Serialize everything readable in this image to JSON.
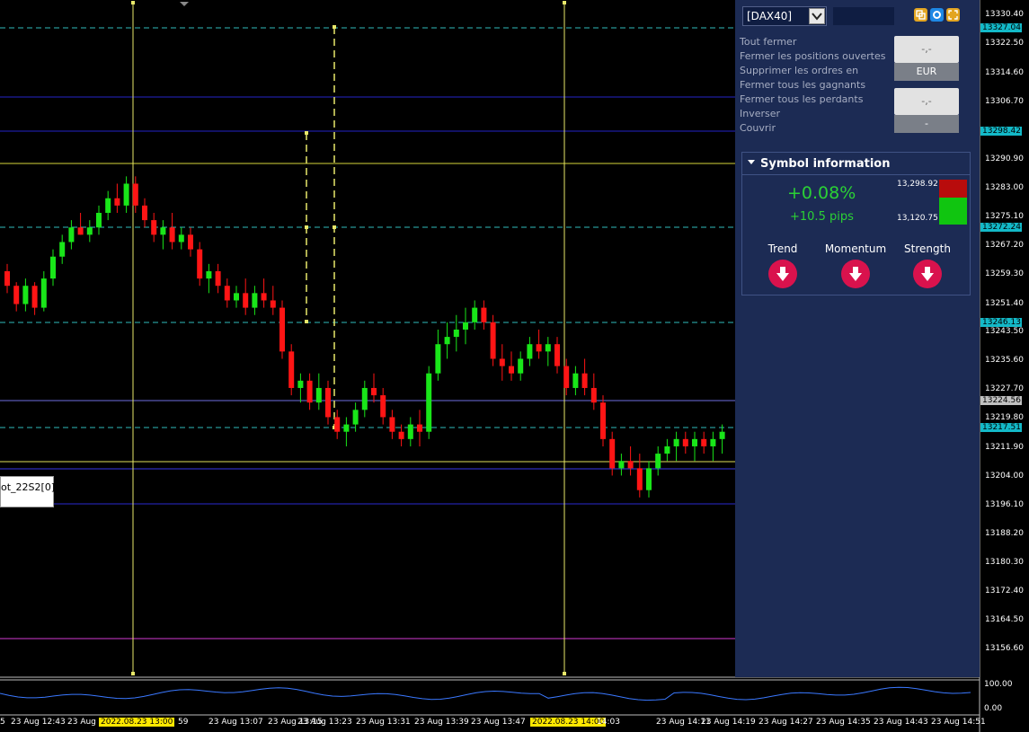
{
  "symbol_panel": {
    "symbol": "[DAX40]",
    "menu": [
      "Tout fermer",
      "Fermer les positions ouvertes",
      "Supprimer les ordres en",
      "Fermer tous les gagnants",
      "Fermer tous les perdants",
      "Inverser",
      "Couvrir"
    ],
    "btn1_value": "-,-",
    "btn1_currency": "EUR",
    "btn2_value": "-,-",
    "btn2_sub": "-"
  },
  "symbol_info": {
    "title": "Symbol information",
    "change_pct": "+0.08%",
    "change_pips": "+10.5 pips",
    "high": "13,298.92",
    "low": "13,120.75",
    "indicators": [
      {
        "label": "Trend",
        "direction": "down"
      },
      {
        "label": "Momentum",
        "direction": "down"
      },
      {
        "label": "Strength",
        "direction": "down"
      }
    ]
  },
  "price_axis": [
    "13330.40",
    "13322.50",
    "13314.60",
    "13306.70",
    "13290.90",
    "13283.00",
    "13275.10",
    "13267.20",
    "13259.30",
    "13251.40",
    "13243.50",
    "13235.60",
    "13227.70",
    "13219.80",
    "13211.90",
    "13204.00",
    "13196.10",
    "13188.20",
    "13180.30",
    "13172.40",
    "13164.50",
    "13156.60"
  ],
  "price_badges": [
    {
      "value": "13327.04",
      "color": "#13b9c8"
    },
    {
      "value": "13298.42",
      "color": "#13b9c8"
    },
    {
      "value": "13272.24",
      "color": "#13b9c8"
    },
    {
      "value": "13246.13",
      "color": "#13b9c8"
    },
    {
      "value": "13224.56",
      "color": "#c0c0c0"
    },
    {
      "value": "13217.51",
      "color": "#13b9c8"
    }
  ],
  "time_axis": [
    "5",
    "23 Aug 12:43",
    "23 Aug",
    "2022.08.23 13:00",
    "59",
    "23 Aug 13:07",
    "23 Aug 13:15",
    "23 Aug 13:23",
    "23 Aug 13:31",
    "23 Aug 13:39",
    "23 Aug 13:47",
    "2022.08.23 14:00",
    "14:03",
    "23 Aug 14:11",
    "23 Aug 14:19",
    "23 Aug 14:27",
    "23 Aug 14:35",
    "23 Aug 14:43",
    "23 Aug 14:51"
  ],
  "oscillator_scale": {
    "top": "100.00",
    "bottom": "0.00"
  },
  "legend_label": "ot_22S2[0]",
  "colors": {
    "bull": "#19e619",
    "bear": "#ff1515",
    "panel_bg": "#1c2b54",
    "accent_red": "#d9124d"
  },
  "chart_data": {
    "type": "candlestick",
    "ylim": [
      13150,
      13334
    ],
    "candles": [
      [
        13260,
        13262,
        13254,
        13256
      ],
      [
        13256,
        13257,
        13249,
        13251
      ],
      [
        13251,
        13258,
        13249,
        13256
      ],
      [
        13256,
        13257,
        13248,
        13250
      ],
      [
        13250,
        13260,
        13249,
        13258
      ],
      [
        13258,
        13266,
        13256,
        13264
      ],
      [
        13264,
        13270,
        13262,
        13268
      ],
      [
        13268,
        13274,
        13266,
        13272
      ],
      [
        13272,
        13276,
        13270,
        13270
      ],
      [
        13270,
        13274,
        13268,
        13272
      ],
      [
        13272,
        13278,
        13270,
        13276
      ],
      [
        13276,
        13282,
        13274,
        13280
      ],
      [
        13280,
        13284,
        13276,
        13278
      ],
      [
        13278,
        13286,
        13276,
        13284
      ],
      [
        13284,
        13286,
        13276,
        13278
      ],
      [
        13278,
        13280,
        13272,
        13274
      ],
      [
        13274,
        13276,
        13268,
        13270
      ],
      [
        13270,
        13274,
        13266,
        13272
      ],
      [
        13272,
        13276,
        13266,
        13268
      ],
      [
        13268,
        13272,
        13266,
        13270
      ],
      [
        13270,
        13272,
        13264,
        13266
      ],
      [
        13266,
        13268,
        13256,
        13258
      ],
      [
        13258,
        13262,
        13254,
        13260
      ],
      [
        13260,
        13262,
        13254,
        13256
      ],
      [
        13256,
        13258,
        13250,
        13252
      ],
      [
        13252,
        13256,
        13250,
        13254
      ],
      [
        13254,
        13258,
        13248,
        13250
      ],
      [
        13250,
        13256,
        13248,
        13254
      ],
      [
        13254,
        13258,
        13250,
        13252
      ],
      [
        13252,
        13256,
        13248,
        13250
      ],
      [
        13250,
        13252,
        13236,
        13238
      ],
      [
        13238,
        13240,
        13226,
        13228
      ],
      [
        13228,
        13232,
        13224,
        13230
      ],
      [
        13230,
        13232,
        13222,
        13224
      ],
      [
        13224,
        13232,
        13222,
        13228
      ],
      [
        13228,
        13230,
        13218,
        13220
      ],
      [
        13220,
        13222,
        13214,
        13216
      ],
      [
        13216,
        13220,
        13212,
        13218
      ],
      [
        13218,
        13224,
        13216,
        13222
      ],
      [
        13222,
        13230,
        13220,
        13228
      ],
      [
        13228,
        13232,
        13224,
        13226
      ],
      [
        13226,
        13228,
        13218,
        13220
      ],
      [
        13220,
        13222,
        13214,
        13216
      ],
      [
        13216,
        13218,
        13212,
        13214
      ],
      [
        13214,
        13220,
        13212,
        13218
      ],
      [
        13218,
        13222,
        13212,
        13216
      ],
      [
        13216,
        13234,
        13214,
        13232
      ],
      [
        13232,
        13244,
        13230,
        13240
      ],
      [
        13240,
        13246,
        13236,
        13242
      ],
      [
        13242,
        13248,
        13238,
        13244
      ],
      [
        13244,
        13250,
        13240,
        13246
      ],
      [
        13246,
        13252,
        13244,
        13250
      ],
      [
        13250,
        13252,
        13244,
        13246
      ],
      [
        13246,
        13248,
        13234,
        13236
      ],
      [
        13236,
        13240,
        13230,
        13234
      ],
      [
        13234,
        13238,
        13230,
        13232
      ],
      [
        13232,
        13238,
        13230,
        13236
      ],
      [
        13236,
        13242,
        13234,
        13240
      ],
      [
        13240,
        13244,
        13236,
        13238
      ],
      [
        13238,
        13242,
        13234,
        13240
      ],
      [
        13240,
        13242,
        13232,
        13234
      ],
      [
        13234,
        13236,
        13226,
        13228
      ],
      [
        13228,
        13234,
        13226,
        13232
      ],
      [
        13232,
        13236,
        13226,
        13228
      ],
      [
        13228,
        13232,
        13222,
        13224
      ],
      [
        13224,
        13226,
        13212,
        13214
      ],
      [
        13214,
        13216,
        13204,
        13206
      ],
      [
        13206,
        13210,
        13204,
        13208
      ],
      [
        13208,
        13212,
        13204,
        13206
      ],
      [
        13206,
        13210,
        13198,
        13200
      ],
      [
        13200,
        13208,
        13198,
        13206
      ],
      [
        13206,
        13212,
        13204,
        13210
      ],
      [
        13210,
        13214,
        13208,
        13212
      ],
      [
        13212,
        13216,
        13208,
        13214
      ],
      [
        13214,
        13216,
        13210,
        13212
      ],
      [
        13212,
        13216,
        13208,
        13214
      ],
      [
        13214,
        13216,
        13210,
        13212
      ],
      [
        13212,
        13216,
        13208,
        13214
      ],
      [
        13214,
        13218,
        13210,
        13216
      ]
    ]
  }
}
